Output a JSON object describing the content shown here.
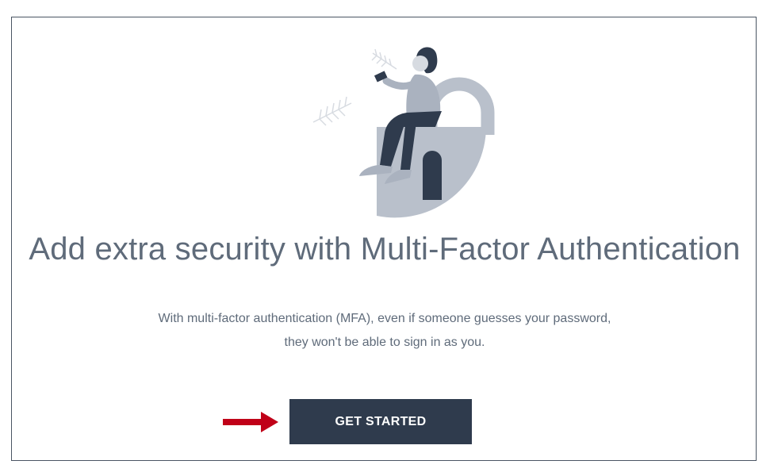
{
  "mfa_prompt": {
    "headline": "Add extra security with Multi-Factor Authentication",
    "description_line1": "With multi-factor authentication (MFA), even if someone guesses your password,",
    "description_line2": "they won't be able to sign in as you.",
    "primary_button_label": "GET STARTED",
    "illustration_icon": "person-on-padlock-illustration",
    "pointer_icon": "red-arrow-icon"
  },
  "colors": {
    "button_bg": "#2f3b4d",
    "text": "#5f6b7a",
    "arrow": "#c00018",
    "frame_border": "#4a5563"
  }
}
